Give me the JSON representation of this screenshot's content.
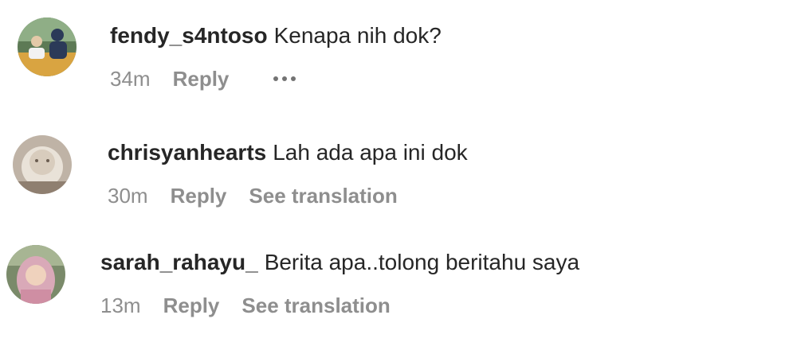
{
  "comments": [
    {
      "username": "fendy_s4ntoso",
      "text": "Kenapa nih dok?",
      "time": "34m",
      "reply_label": "Reply",
      "more_icon": "more-options-icon"
    },
    {
      "username": "chrisyanhearts",
      "text": "Lah ada apa ini dok",
      "time": "30m",
      "reply_label": "Reply",
      "translation_label": "See translation"
    },
    {
      "username": "sarah_rahayu_",
      "text": "Berita apa..tolong beritahu saya",
      "time": "13m",
      "reply_label": "Reply",
      "translation_label": "See translation"
    }
  ],
  "colors": {
    "primary_text": "#262626",
    "secondary_text": "#8e8e8e",
    "background": "#ffffff"
  }
}
